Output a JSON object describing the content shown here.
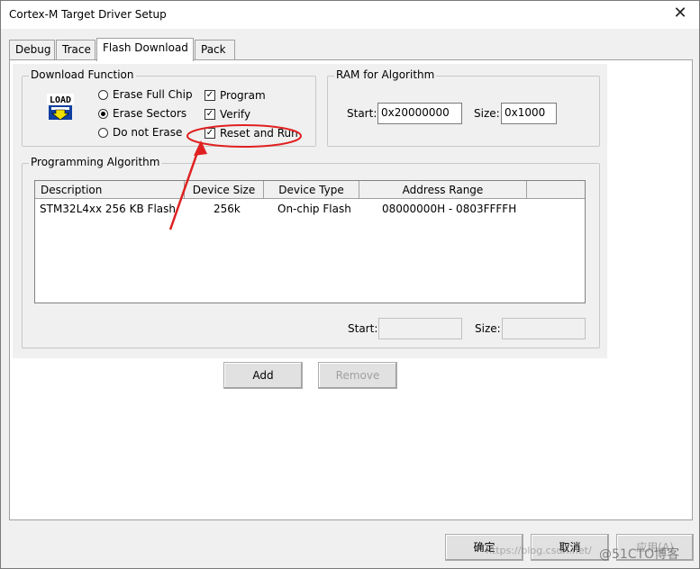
{
  "window": {
    "title": "Cortex-M Target Driver Setup",
    "close_glyph": "✕"
  },
  "tabs": [
    {
      "label": "Debug"
    },
    {
      "label": "Trace"
    },
    {
      "label": "Flash Download"
    },
    {
      "label": "Pack"
    }
  ],
  "download_function": {
    "label": "Download Function",
    "icon_text": "LOAD",
    "radios": [
      {
        "label": "Erase Full Chip",
        "selected": false
      },
      {
        "label": "Erase Sectors",
        "selected": true
      },
      {
        "label": "Do not Erase",
        "selected": false
      }
    ],
    "checks": [
      {
        "label": "Program",
        "checked": true
      },
      {
        "label": "Verify",
        "checked": true
      },
      {
        "label": "Reset and Run",
        "checked": true
      }
    ]
  },
  "ram": {
    "label": "RAM for Algorithm",
    "start_label": "Start:",
    "start_value": "0x20000000",
    "size_label": "Size:",
    "size_value": "0x1000"
  },
  "programming": {
    "label": "Programming Algorithm",
    "columns": [
      "Description",
      "Device Size",
      "Device Type",
      "Address Range"
    ],
    "rows": [
      [
        "STM32L4xx 256 KB Flash",
        "256k",
        "On-chip Flash",
        "08000000H - 0803FFFFH"
      ]
    ],
    "start_label": "Start:",
    "start_value": "",
    "size_label": "Size:",
    "size_value": ""
  },
  "buttons": {
    "add": "Add",
    "remove": "Remove"
  },
  "footer": {
    "ok": "确定",
    "cancel": "取消",
    "apply": "应用(A)"
  },
  "watermark": {
    "url": "https://blog.csdn.net/",
    "brand": "@51CTO博客"
  },
  "annotation_color": "#e02020"
}
